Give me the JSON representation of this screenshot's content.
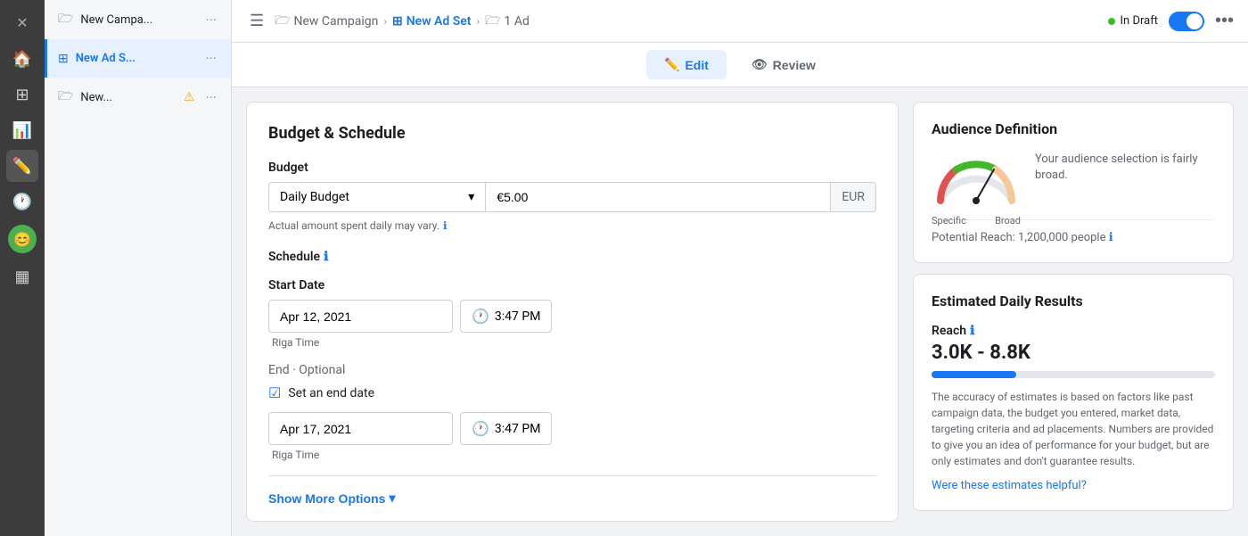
{
  "iconBar": {
    "items": [
      {
        "name": "home-icon",
        "icon": "🏠",
        "active": false
      },
      {
        "name": "grid-icon",
        "icon": "⊞",
        "active": false
      },
      {
        "name": "chart-icon",
        "icon": "📊",
        "active": false
      },
      {
        "name": "edit-icon",
        "icon": "✏️",
        "active": true
      },
      {
        "name": "clock-icon",
        "icon": "🕐",
        "active": false
      },
      {
        "name": "face-icon",
        "icon": "😊",
        "active": false
      },
      {
        "name": "list-icon",
        "icon": "▦",
        "active": false
      }
    ],
    "closeBtn": "✕"
  },
  "sidebar": {
    "items": [
      {
        "label": "New Campa...",
        "icon": "🗁",
        "iconColor": "default",
        "active": false,
        "warning": false
      },
      {
        "label": "New Ad S...",
        "icon": "⊞",
        "iconColor": "blue",
        "active": true,
        "warning": false
      },
      {
        "label": "New...",
        "icon": "🗁",
        "iconColor": "default",
        "active": false,
        "warning": true
      }
    ]
  },
  "breadcrumb": {
    "items": [
      {
        "label": "New Campaign",
        "icon": "🗁",
        "active": false
      },
      {
        "label": "New Ad Set",
        "icon": "⊞",
        "active": true
      },
      {
        "label": "1 Ad",
        "icon": "🗁",
        "active": false
      }
    ]
  },
  "topNav": {
    "draftLabel": "In Draft",
    "moreIcon": "•••"
  },
  "tabs": {
    "edit": "Edit",
    "review": "Review"
  },
  "mainPanel": {
    "sectionTitle": "Budget & Schedule",
    "budget": {
      "fieldLabel": "Budget",
      "dropdownValue": "Daily Budget",
      "inputValue": "€5.00",
      "currency": "EUR",
      "hintText": "Actual amount spent daily may vary."
    },
    "schedule": {
      "title": "Schedule",
      "startDate": {
        "label": "Start Date",
        "date": "Apr 12, 2021",
        "time": "3:47 PM",
        "timezone": "Riga Time"
      },
      "end": {
        "label": "End",
        "optional": "· Optional",
        "checkboxLabel": "Set an end date",
        "date": "Apr 17, 2021",
        "time": "3:47 PM",
        "timezone": "Riga Time"
      }
    },
    "showMoreOptions": "Show More Options"
  },
  "rightPanel": {
    "audience": {
      "title": "Audience Definition",
      "description": "Your audience selection is fairly broad.",
      "specificLabel": "Specific",
      "broadLabel": "Broad",
      "potentialReach": "Potential Reach: 1,200,000 people"
    },
    "results": {
      "title": "Estimated Daily Results",
      "reachLabel": "Reach",
      "reachRange": "3.0K - 8.8K",
      "description": "The accuracy of estimates is based on factors like past campaign data, the budget you entered, market data, targeting criteria and ad placements. Numbers are provided to give you an idea of performance for your budget, but are only estimates and don't guarantee results.",
      "helpfulLink": "Were these estimates helpful?"
    }
  }
}
